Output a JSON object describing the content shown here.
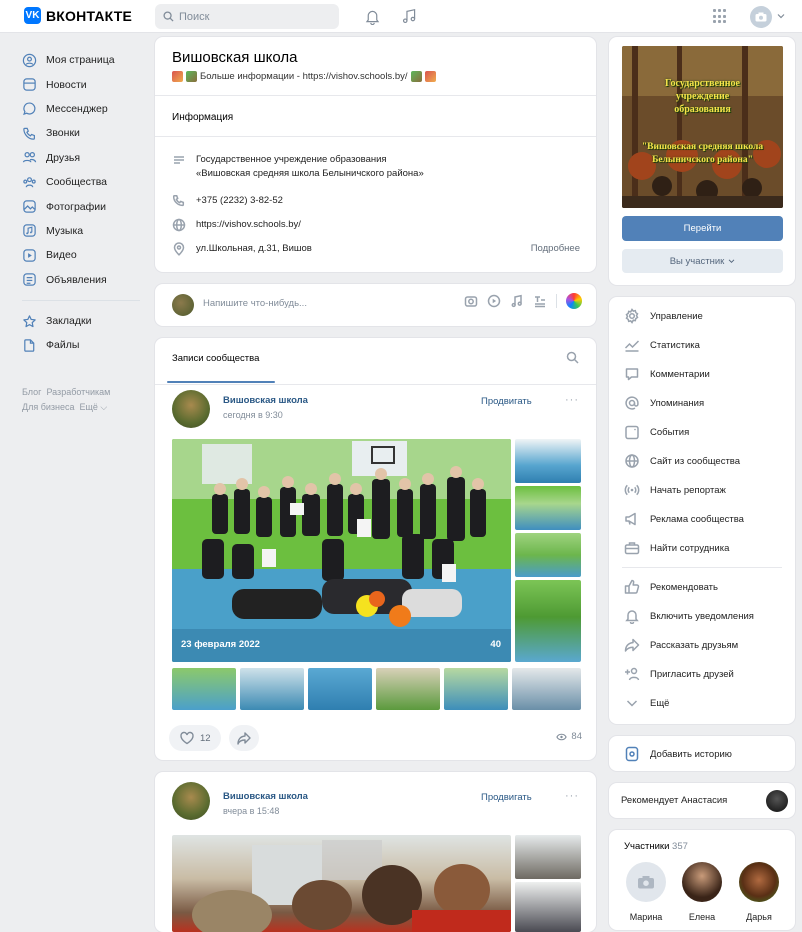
{
  "topbar": {
    "logo_mark": "VK",
    "logo_text": "ВКОНТАКТЕ",
    "search_placeholder": "Поиск"
  },
  "leftnav": {
    "items": [
      {
        "label": "Моя страница",
        "icon": "user-circle-icon"
      },
      {
        "label": "Новости",
        "icon": "news-icon"
      },
      {
        "label": "Мессенджер",
        "icon": "message-icon"
      },
      {
        "label": "Звонки",
        "icon": "phone-icon"
      },
      {
        "label": "Друзья",
        "icon": "friends-icon"
      },
      {
        "label": "Сообщества",
        "icon": "communities-icon"
      },
      {
        "label": "Фотографии",
        "icon": "photo-icon"
      },
      {
        "label": "Музыка",
        "icon": "music-icon"
      },
      {
        "label": "Видео",
        "icon": "video-icon"
      },
      {
        "label": "Объявления",
        "icon": "ads-icon"
      }
    ],
    "extra": [
      {
        "label": "Закладки",
        "icon": "star-icon"
      },
      {
        "label": "Файлы",
        "icon": "file-icon"
      }
    ],
    "footer": [
      "Блог",
      "Разработчикам",
      "Для бизнеса",
      "Ещё ⌵"
    ]
  },
  "group": {
    "name": "Вишовская школа",
    "status": "Больше информации - https://vishov.schools.by/",
    "info_tab": "Информация",
    "description_line1": "Государственное учреждение образования",
    "description_line2": "«Вишовская средняя школа Белыничского района»",
    "phone": "+375 (2232) 3-82-52",
    "site": "https://vishov.schools.by/",
    "address": "ул.Школьная, д.31, Вишов",
    "more_link": "Подробнее"
  },
  "composer": {
    "placeholder": "Напишите что-нибудь..."
  },
  "feed": {
    "tab": "Записи сообщества"
  },
  "posts": [
    {
      "author": "Вишовская школа",
      "time": "сегодня в 9:30",
      "promote": "Продвигать",
      "dots": "···",
      "photo_date": "23 февраля 2022",
      "photo_count": "40",
      "likes": "12",
      "views": "84"
    },
    {
      "author": "Вишовская школа",
      "time": "вчера в 15:48",
      "promote": "Продвигать",
      "dots": "···"
    }
  ],
  "right": {
    "cover_line1": "Государственное",
    "cover_line2": "учреждение",
    "cover_line3": "образования",
    "cover_line4": "\"Вишовская средняя школа",
    "cover_line5": "Белыничского района\"",
    "go_button": "Перейти",
    "member_button": "Вы участник",
    "menu": [
      {
        "label": "Управление",
        "icon": "gear-icon"
      },
      {
        "label": "Статистика",
        "icon": "stats-icon"
      },
      {
        "label": "Комментарии",
        "icon": "comment-icon"
      },
      {
        "label": "Упоминания",
        "icon": "at-icon"
      },
      {
        "label": "События",
        "icon": "calendar-icon"
      },
      {
        "label": "Сайт из сообщества",
        "icon": "globe-icon"
      },
      {
        "label": "Начать репортаж",
        "icon": "broadcast-icon"
      },
      {
        "label": "Реклама сообщества",
        "icon": "megaphone-icon"
      },
      {
        "label": "Найти сотрудника",
        "icon": "briefcase-icon"
      }
    ],
    "menu2": [
      {
        "label": "Рекомендовать",
        "icon": "thumb-up-icon"
      },
      {
        "label": "Включить уведомления",
        "icon": "bell-icon"
      },
      {
        "label": "Рассказать друзьям",
        "icon": "share-icon"
      },
      {
        "label": "Пригласить друзей",
        "icon": "add-user-icon"
      },
      {
        "label": "Ещё",
        "icon": "chevron-down-icon"
      }
    ],
    "add_story": "Добавить историю",
    "recommends": "Рекомендует Анастасия",
    "members_title": "Участники",
    "members_count": "357",
    "members": [
      "Марина",
      "Елена",
      "Дарья"
    ]
  },
  "colors": {
    "accent": "#5181b8",
    "link": "#2a5885",
    "background": "#edeef0",
    "logo": "#0077ff"
  }
}
